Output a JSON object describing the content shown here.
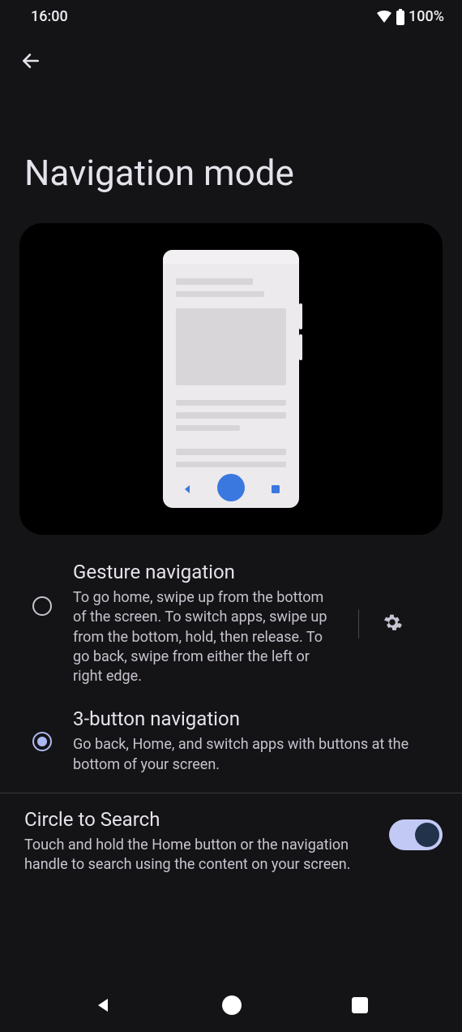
{
  "status_bar": {
    "time": "16:00",
    "battery_label": "100%"
  },
  "page_title": "Navigation mode",
  "options": [
    {
      "id": "gesture",
      "title": "Gesture navigation",
      "description": "To go home, swipe up from the bottom of the screen. To switch apps, swipe up from the bottom, hold, then release. To go back, swipe from either the left or right edge.",
      "selected": false,
      "has_settings": true
    },
    {
      "id": "three-button",
      "title": "3-button navigation",
      "description": "Go back, Home, and switch apps with buttons at the bottom of your screen.",
      "selected": true,
      "has_settings": false
    }
  ],
  "circle_to_search": {
    "title": "Circle to Search",
    "description": "Touch and hold the Home button or the navigation handle to search using the content on your screen.",
    "enabled": true
  }
}
